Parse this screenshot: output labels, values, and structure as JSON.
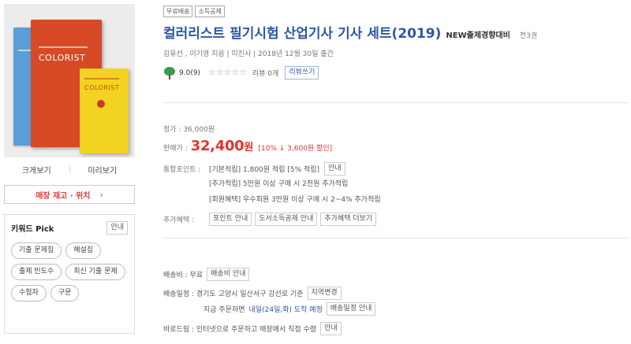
{
  "colors": {
    "title_blue": "#2d57a8",
    "sale_red": "#e8322d",
    "book_blue": "#5b9fd6",
    "book_red": "#d84a26",
    "book_yellow": "#f2d321"
  },
  "cover": {
    "book_title": "COLORIST",
    "book_title_front": "COLORIST"
  },
  "left": {
    "view_large": "크게보기",
    "view_preview": "미리보기",
    "stock_button": "매장 재고 · 위치",
    "stock_chevron": "›",
    "keyword": {
      "title": "키워드 Pick",
      "guide": "안내",
      "tags": [
        "기출 문제집",
        "해설집",
        "출제 빈도수",
        "최신 기출 문제",
        "수험자",
        "구문"
      ]
    }
  },
  "product": {
    "badges": [
      "무료배송",
      "소득공제"
    ],
    "title": "컬러리스트 필기시험 산업기사 기사 세트(2019)",
    "title_extra": "NEW출제경향대비",
    "volumes": "전3권",
    "author_line": "김유선 , 이기영 지음 | 미진사 | 2018년 12월 30일 출간",
    "score": "9.0(9)",
    "stars": "☆☆☆☆☆",
    "review_count": "리뷰 0개",
    "review_btn": "리뷰쓰기"
  },
  "price": {
    "original": "정가 : 36,000원",
    "sale_label": "판매가 :",
    "sale_price": "32,400",
    "won": "원",
    "discount": "[10% ↓ 3,600원 할인]"
  },
  "points": {
    "label": "통합포인트 :",
    "basic": "[기본적립] 1,800원 적립 [5% 적립]",
    "guide": "안내",
    "extra": "[추가적립] 5만원 이상 구매 시 2천원 추가적립",
    "member": "[회원혜택] 우수회원 3만원 이상 구매 시 2~4% 추가적립"
  },
  "benefits": {
    "label": "추가혜택 :",
    "btn1": "포인트 안내",
    "btn2": "도서소득공제 안내",
    "btn3": "추가혜택 더보기"
  },
  "shipping": {
    "fee_text": "배송비 : 무료",
    "fee_btn": "배송비 안내",
    "schedule_text": "배송일정 : 경기도 고양시 일산서구 강선로 기준",
    "region_btn": "지역변경",
    "order_prefix": "지금 주문하면",
    "order_date": "내일(24일,화) 도착 예정",
    "schedule_btn": "배송일정 안내",
    "baro_text": "바로드림 : 인터넷으로 주문하고 매장에서 직접 수령",
    "baro_btn": "안내"
  }
}
